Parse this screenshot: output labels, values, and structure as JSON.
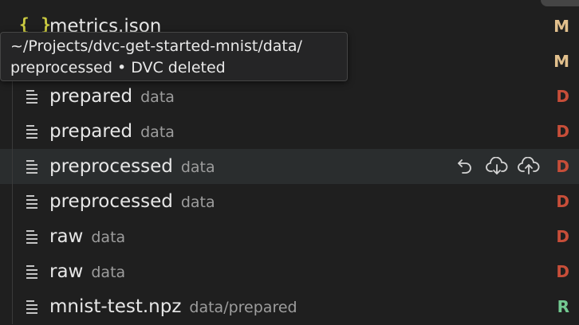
{
  "rows": [
    {
      "name": "metrics.json",
      "desc": "",
      "status": "M",
      "icon": "json-icon"
    },
    {
      "name": "",
      "desc": "",
      "status": "M",
      "icon": "none"
    },
    {
      "name": "prepared",
      "desc": "data",
      "status": "D",
      "icon": "file-lines-icon"
    },
    {
      "name": "prepared",
      "desc": "data",
      "status": "D",
      "icon": "file-lines-icon"
    },
    {
      "name": "preprocessed",
      "desc": "data",
      "status": "D",
      "icon": "file-lines-icon"
    },
    {
      "name": "preprocessed",
      "desc": "data",
      "status": "D",
      "icon": "file-lines-icon"
    },
    {
      "name": "raw",
      "desc": "data",
      "status": "D",
      "icon": "file-lines-icon"
    },
    {
      "name": "raw",
      "desc": "data",
      "status": "D",
      "icon": "file-lines-icon"
    },
    {
      "name": "mnist-test.npz",
      "desc": "data/prepared",
      "status": "R",
      "icon": "file-lines-icon"
    }
  ],
  "hover_actions": [
    "discard-changes-icon",
    "cloud-download-icon",
    "cloud-upload-icon"
  ],
  "tooltip": {
    "line1": "~/Projects/dvc-get-started-mnist/data/",
    "line2": "preprocessed • DVC deleted"
  },
  "colors": {
    "deleted": "#c74e39",
    "modified": "#e2c08d",
    "renamed": "#73c991",
    "background": "#1f1f1f",
    "hover_row": "#2a2d2e"
  }
}
